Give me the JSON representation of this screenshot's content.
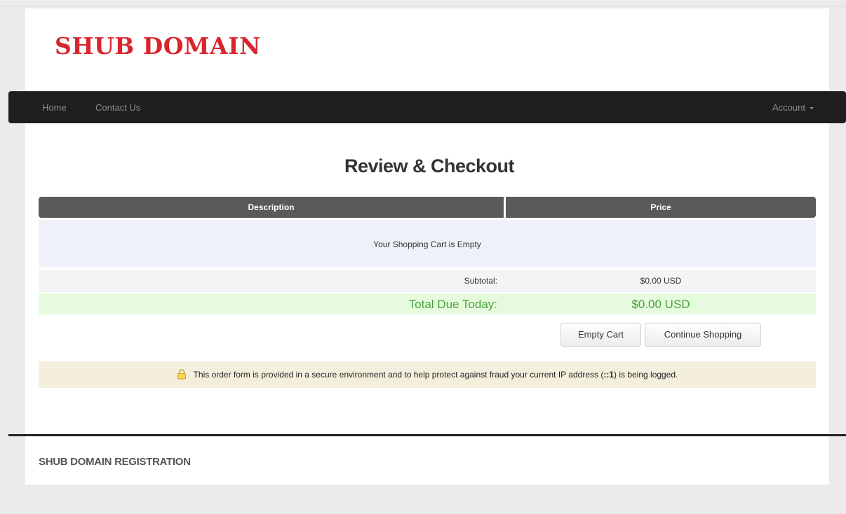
{
  "brand": {
    "logo_text": "SHUB DOMAIN"
  },
  "nav": {
    "items": [
      {
        "label": "Home"
      },
      {
        "label": "Contact Us"
      }
    ],
    "account_label": "Account"
  },
  "page_title": "Review & Checkout",
  "cart": {
    "columns": [
      "Description",
      "Price"
    ],
    "empty_message": "Your Shopping Cart is Empty",
    "subtotal_label": "Subtotal:",
    "subtotal_value": "$0.00 USD",
    "total_label": "Total Due Today:",
    "total_value": "$0.00 USD"
  },
  "actions": {
    "empty_cart": "Empty Cart",
    "continue_shopping": "Continue Shopping"
  },
  "secure_notice": {
    "text_before": "This order form is provided in a secure environment and to help protect against fraud your current IP address (",
    "ip": "::1",
    "text_after": ") is being logged."
  },
  "footer": {
    "text": "SHUB DOMAIN REGISTRATION"
  },
  "colors": {
    "logo": "#d8262e",
    "navbar": "#1e1e1e",
    "table_header": "#5a5a5a",
    "total_text": "#4aa13d",
    "total_row": "#e6fbde",
    "notice_bg": "#f4efdd"
  }
}
